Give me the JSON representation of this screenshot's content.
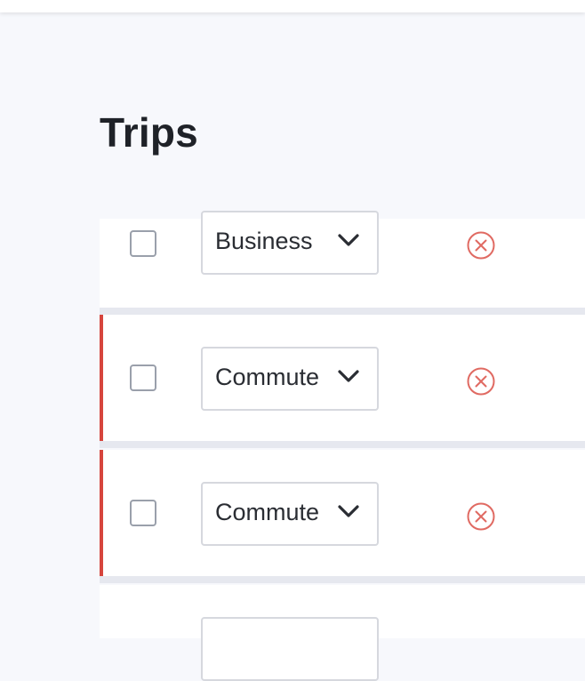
{
  "page": {
    "title": "Trips"
  },
  "colors": {
    "background": "#f7f8fc",
    "card": "#ffffff",
    "flag": "#d6453d",
    "delete_icon": "#e06a62",
    "text": "#1f2228"
  },
  "trips": [
    {
      "category": "Business",
      "checked": false,
      "flagged": false,
      "delete_icon": "circle-x-icon"
    },
    {
      "category": "Commute",
      "checked": false,
      "flagged": true,
      "delete_icon": "circle-x-icon"
    },
    {
      "category": "Commute",
      "checked": false,
      "flagged": true,
      "delete_icon": "circle-x-icon"
    },
    {
      "category": "",
      "checked": false,
      "flagged": false,
      "delete_icon": "circle-x-icon"
    }
  ]
}
